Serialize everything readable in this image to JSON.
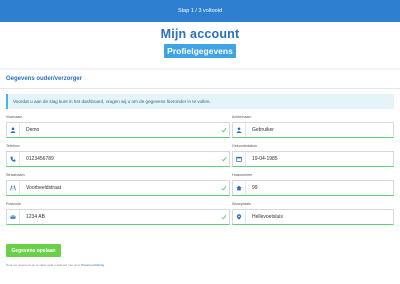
{
  "topbar": {
    "step": "Stap 1 / 3 voltooid"
  },
  "header": {
    "title": "Mijn account",
    "subtitle": "Profielgegevens"
  },
  "card": {
    "heading": "Gegevens ouder/verzorger"
  },
  "alert": {
    "text": "Voordat u aan de slag kunt in het dashboard, vragen wij u om de gegevens hieronder in te vullen."
  },
  "fields": {
    "voornaam": {
      "label": "Voornaam",
      "value": "Demo"
    },
    "achternaam": {
      "label": "Achternaam",
      "value": "Gebruiker"
    },
    "telefoon": {
      "label": "Telefoon",
      "value": "0123456789"
    },
    "geboortedatum": {
      "label": "Geboortedatum",
      "value": "19-04-1985"
    },
    "straatnaam": {
      "label": "Straatnaam",
      "value": "Voorbeeldstraat"
    },
    "huisnummer": {
      "label": "Huisnummer",
      "value": "99"
    },
    "postcode": {
      "label": "Postcode",
      "value": "1234 AB"
    },
    "woonplaats": {
      "label": "Woonplaats",
      "value": "Hellevoetsluis"
    }
  },
  "save_button": {
    "label": "Gegevens opslaan"
  },
  "footnote": {
    "text": "Door uw gegevens op te slaan gaat u akkoord met onze",
    "link": "Privacyverklaring"
  },
  "colors": {
    "accent": "#2a6fc0",
    "valid": "#5fd07a",
    "button": "#6ad04a",
    "topbar": "#2f7fd0"
  }
}
